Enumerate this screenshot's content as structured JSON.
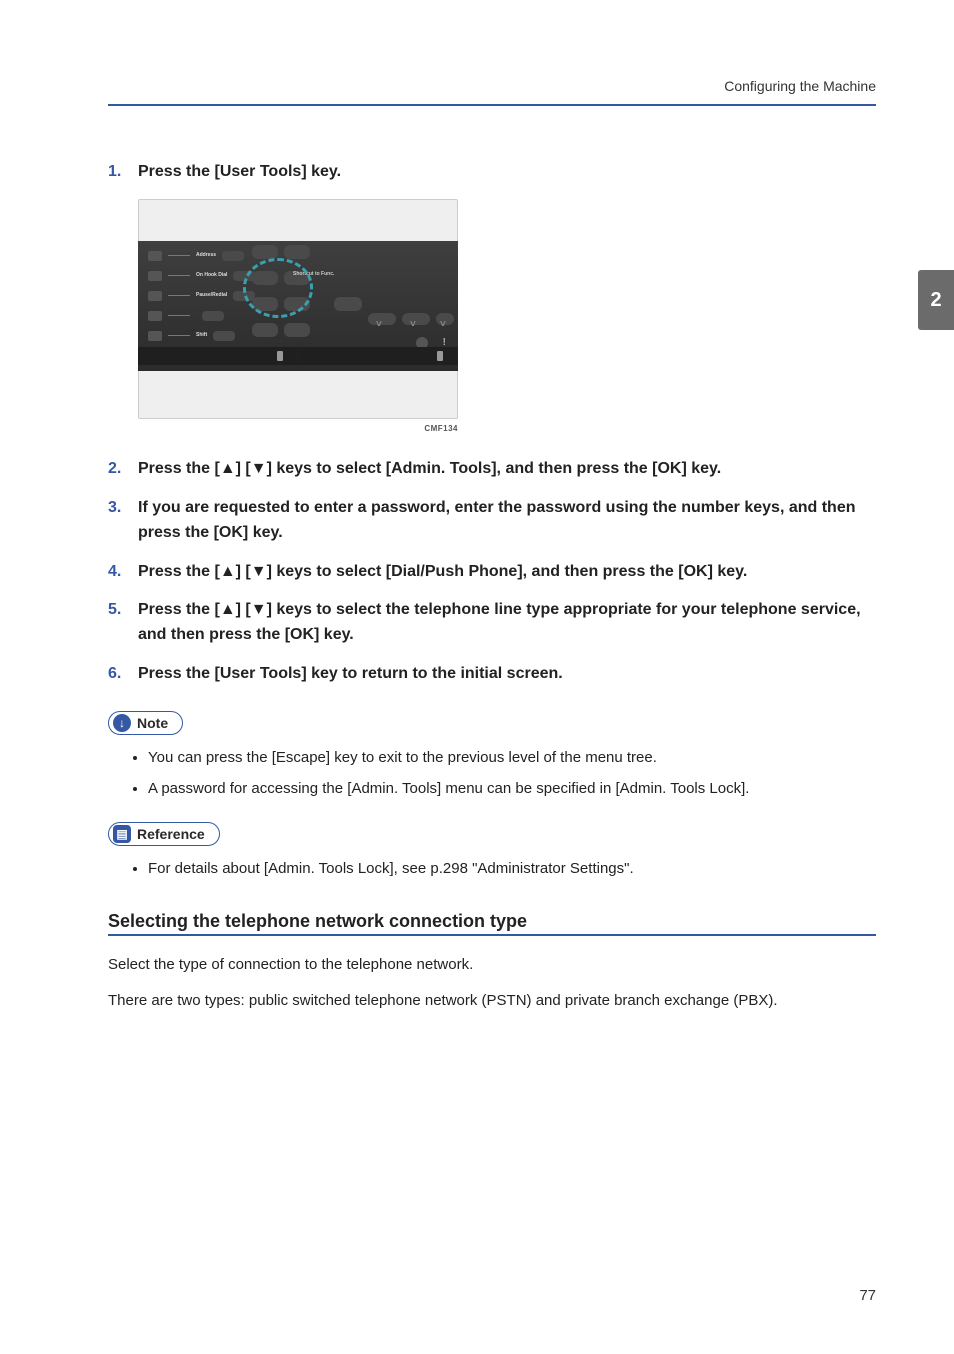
{
  "header": {
    "running_title": "Configuring the Machine"
  },
  "chapter_tab": "2",
  "steps": [
    {
      "text": "Press the [User Tools] key."
    },
    {
      "text": "Press the [▲] [▼] keys to select [Admin. Tools], and then press the [OK] key."
    },
    {
      "text": "If you are requested to enter a password, enter the password using the number keys, and then press the [OK] key."
    },
    {
      "text": "Press the [▲] [▼] keys to select [Dial/Push Phone], and then press the [OK] key."
    },
    {
      "text": "Press the [▲] [▼] keys to select the telephone line type appropriate for your telephone service, and then press the [OK] key."
    },
    {
      "text": "Press the [User Tools] key to return to the initial screen."
    }
  ],
  "figure": {
    "id": "CMF134",
    "panel_rows": [
      "Address",
      "On Hook Dial",
      "Pause/Redial",
      "",
      "Shift"
    ],
    "small_label": "Shortcut to Func."
  },
  "note_label": "Note",
  "notes": [
    "You can press the [Escape] key to exit to the previous level of the menu tree.",
    "A password for accessing the [Admin. Tools] menu can be specified in [Admin. Tools Lock]."
  ],
  "reference_label": "Reference",
  "references": [
    "For details about [Admin. Tools Lock], see p.298 \"Administrator Settings\"."
  ],
  "subsection": {
    "heading": "Selecting the telephone network connection type",
    "paras": [
      "Select the type of connection to the telephone network.",
      "There are two types: public switched telephone network (PSTN) and private branch exchange (PBX)."
    ]
  },
  "page_number": "77"
}
